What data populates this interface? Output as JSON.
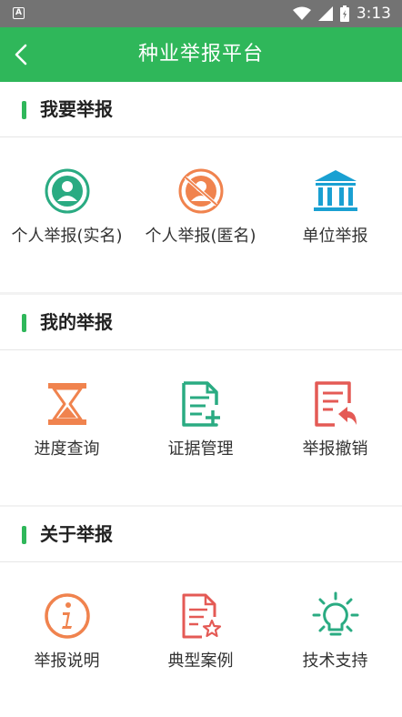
{
  "status_bar": {
    "time": "3:13",
    "left_icon": "A"
  },
  "app_bar": {
    "title": "种业举报平台",
    "back_icon": "chevron-left-icon"
  },
  "colors": {
    "primary": "#2fb75a",
    "orange": "#f0834e",
    "red": "#e45a55",
    "teal": "#2aab82",
    "blue": "#1aa0d2"
  },
  "sections": [
    {
      "title": "我要举报",
      "items": [
        {
          "label": "个人举报(实名)",
          "icon": "person-icon"
        },
        {
          "label": "个人举报(匿名)",
          "icon": "anonymous-person-icon"
        },
        {
          "label": "单位举报",
          "icon": "building-icon"
        }
      ]
    },
    {
      "title": "我的举报",
      "items": [
        {
          "label": "进度查询",
          "icon": "hourglass-icon"
        },
        {
          "label": "证据管理",
          "icon": "document-add-icon"
        },
        {
          "label": "举报撤销",
          "icon": "document-undo-icon"
        }
      ]
    },
    {
      "title": "关于举报",
      "items": [
        {
          "label": "举报说明",
          "icon": "info-icon"
        },
        {
          "label": "典型案例",
          "icon": "document-star-icon"
        },
        {
          "label": "技术支持",
          "icon": "lightbulb-icon"
        }
      ]
    }
  ]
}
